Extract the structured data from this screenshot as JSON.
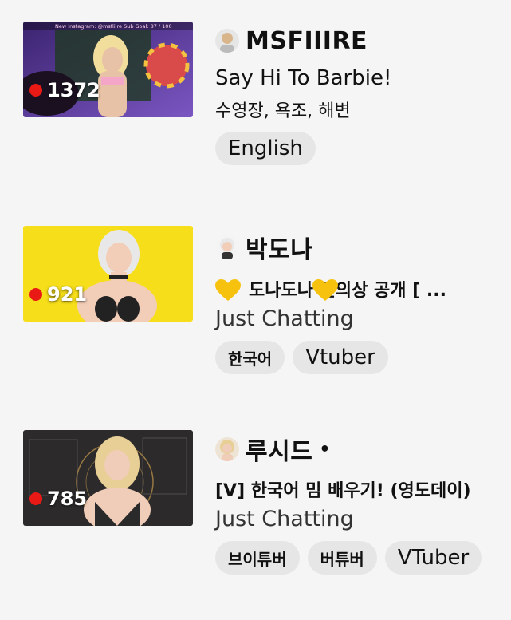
{
  "streams": [
    {
      "viewers": "1372",
      "name": "MSFIIIRE",
      "title": "Say Hi To Barbie!",
      "subtitle": "수영장, 욕조, 해변",
      "category": "",
      "tags": [
        "English"
      ],
      "overlay_text": "New Instagram: @msfiiire    Sub Goal: 87 / 100",
      "colors": {
        "bg1": "#4b2a8a",
        "bg2": "#9b6dd6",
        "skin": "#e8c2a6",
        "hair": "#f1dd9c"
      }
    },
    {
      "viewers": "921",
      "name": "박도나",
      "title_text": "도나도나   신의상 공개  [ ...",
      "category": "Just Chatting",
      "tags": [
        "한국어",
        "Vtuber"
      ],
      "colors": {
        "bg": "#f6de1a",
        "skin": "#f2cdb8",
        "hair": "#e8e8e8",
        "outfit": "#222222"
      }
    },
    {
      "viewers": "785",
      "name": "루시드",
      "name_suffix": "•",
      "title": "[V] 한국어 밈 배우기! (영도데이)",
      "category": "Just Chatting",
      "tags": [
        "브이튜버",
        "버튜버",
        "VTuber"
      ],
      "colors": {
        "bg": "#2c2a2b",
        "accent": "#c49a4d",
        "skin": "#f0cdb8",
        "hair": "#e7cf95"
      }
    }
  ]
}
